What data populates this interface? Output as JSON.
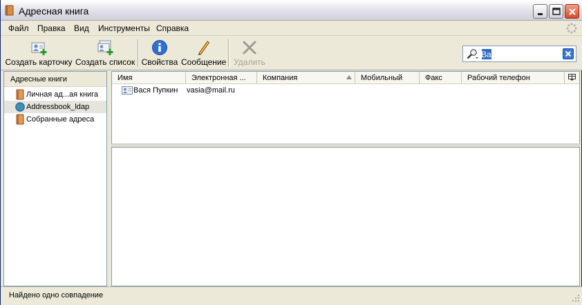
{
  "window": {
    "title": "Адресная книга"
  },
  "menu": [
    {
      "label": "Файл"
    },
    {
      "label": "Правка"
    },
    {
      "label": "Вид"
    },
    {
      "label": "Инструменты"
    },
    {
      "label": "Справка"
    }
  ],
  "toolbar": {
    "new_card": "Создать карточку",
    "new_list": "Создать список",
    "properties": "Свойства",
    "message": "Сообщение",
    "delete": "Удалить"
  },
  "search": {
    "value": "Ва"
  },
  "sidebar": {
    "header": "Адресные книги",
    "items": [
      {
        "label": "Личная ад...ая книга",
        "icon": "book-icon"
      },
      {
        "label": "Addressbook_ldap",
        "icon": "globe-icon",
        "selected": true
      },
      {
        "label": "Собранные адреса",
        "icon": "book-icon"
      }
    ]
  },
  "columns": [
    "Имя",
    "Электронная ...",
    "Компания",
    "Мобильный",
    "Факс",
    "Рабочий телефон"
  ],
  "rows": [
    {
      "name": "Вася Пупкин",
      "email": "vasia@mail.ru"
    }
  ],
  "status": {
    "text": "Найдено одно совпадение"
  },
  "colors": {
    "accent": "#316ac5",
    "window_bg": "#ece9d8",
    "border": "#7f9db9"
  }
}
